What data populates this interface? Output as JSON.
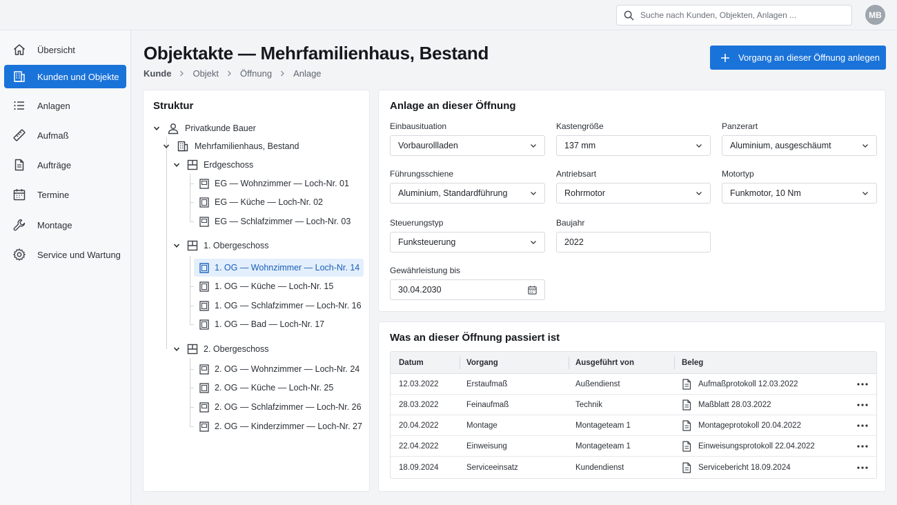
{
  "search": {
    "placeholder": "Suche nach Kunden, Objekten, Anlagen ..."
  },
  "user": {
    "initials": "MB"
  },
  "sidebar": {
    "items": [
      {
        "label": "Übersicht",
        "icon": "home-icon",
        "active": false
      },
      {
        "label": "Kunden und Objekte",
        "icon": "building-icon",
        "active": true
      },
      {
        "label": "Anlagen",
        "icon": "list-icon",
        "active": false
      },
      {
        "label": "Aufmaß",
        "icon": "ruler-icon",
        "active": false
      },
      {
        "label": "Aufträge",
        "icon": "document-icon",
        "active": false
      },
      {
        "label": "Termine",
        "icon": "calendar-icon",
        "active": false
      },
      {
        "label": "Montage",
        "icon": "wrench-icon",
        "active": false
      },
      {
        "label": "Service und Wartung",
        "icon": "gear-icon",
        "active": false
      }
    ]
  },
  "header": {
    "title": "Objektakte — Mehrfamilienhaus, Bestand",
    "breadcrumb": [
      "Kunde",
      "Objekt",
      "Öffnung",
      "Anlage"
    ],
    "primary_action": "Vorgang an dieser Öffnung anlegen"
  },
  "structure": {
    "title": "Struktur",
    "customer": "Privatkunde Bauer",
    "building": "Mehrfamilienhaus, Bestand",
    "floors": [
      {
        "name": "Erdgeschoss",
        "rooms": [
          "EG — Wohnzimmer — Loch-Nr. 01",
          "EG — Küche — Loch-Nr. 02",
          "EG — Schlafzimmer — Loch-Nr. 03"
        ]
      },
      {
        "name": "1. Obergeschoss",
        "rooms": [
          "1. OG — Wohnzimmer — Loch-Nr. 14",
          "1. OG — Küche — Loch-Nr. 15",
          "1. OG — Schlafzimmer — Loch-Nr. 16",
          "1. OG — Bad — Loch-Nr. 17"
        ]
      },
      {
        "name": "2. Obergeschoss",
        "rooms": [
          "2. OG — Wohnzimmer — Loch-Nr. 24",
          "2. OG — Küche — Loch-Nr. 25",
          "2. OG — Schlafzimmer — Loch-Nr. 26",
          "2. OG — Kinderzimmer — Loch-Nr. 27"
        ]
      }
    ],
    "selected": "1. OG — Wohnzimmer — Loch-Nr. 14"
  },
  "anlage": {
    "title": "Anlage an dieser Öffnung",
    "fields": {
      "einbausituation": {
        "label": "Einbausituation",
        "value": "Vorbaurollladen"
      },
      "kastengroesse": {
        "label": "Kastengröße",
        "value": "137 mm"
      },
      "panzerart": {
        "label": "Panzerart",
        "value": "Aluminium, ausgeschäumt"
      },
      "fuehrungsschiene": {
        "label": "Führungsschiene",
        "value": "Aluminium, Standardführung"
      },
      "antriebsart": {
        "label": "Antriebsart",
        "value": "Rohrmotor"
      },
      "motortyp": {
        "label": "Motortyp",
        "value": "Funkmotor, 10 Nm"
      },
      "steuerungstyp": {
        "label": "Steuerungstyp",
        "value": "Funksteuerung"
      },
      "baujahr": {
        "label": "Baujahr",
        "value": "2022"
      },
      "gewaehrleistung": {
        "label": "Gewährleistung bis",
        "value": "30.04.2030"
      }
    }
  },
  "history": {
    "title": "Was an dieser Öffnung passiert ist",
    "columns": [
      "Datum",
      "Vorgang",
      "Ausgeführt von",
      "Beleg"
    ],
    "rows": [
      {
        "datum": "12.03.2022",
        "vorgang": "Erstaufmaß",
        "von": "Außendienst",
        "beleg": "Aufmaßprotokoll 12.03.2022"
      },
      {
        "datum": "28.03.2022",
        "vorgang": "Feinaufmaß",
        "von": "Technik",
        "beleg": "Maßblatt 28.03.2022"
      },
      {
        "datum": "20.04.2022",
        "vorgang": "Montage",
        "von": "Montageteam 1",
        "beleg": "Montageprotokoll 20.04.2022"
      },
      {
        "datum": "22.04.2022",
        "vorgang": "Einweisung",
        "von": "Montageteam 1",
        "beleg": "Einweisungsprotokoll 22.04.2022"
      },
      {
        "datum": "18.09.2024",
        "vorgang": "Serviceeinsatz",
        "von": "Kundendienst",
        "beleg": "Servicebericht 18.09.2024"
      }
    ]
  },
  "colors": {
    "accent": "#1a73d9",
    "selected_bg": "#e3effc"
  }
}
